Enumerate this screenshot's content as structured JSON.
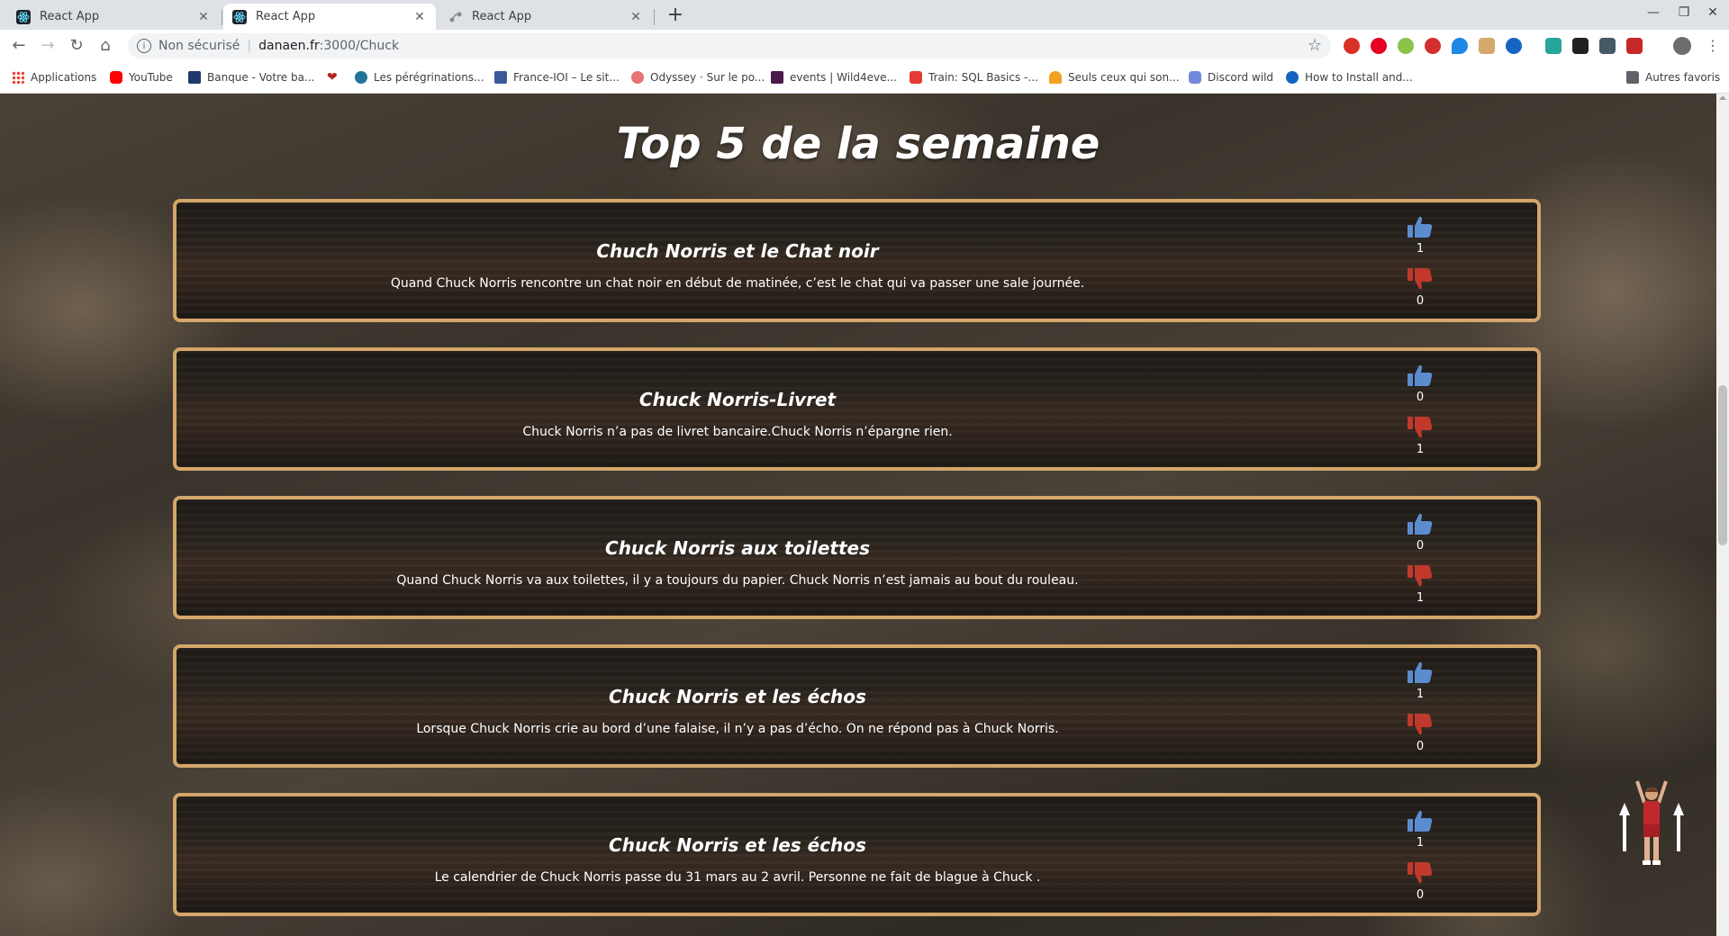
{
  "browser": {
    "tabs": [
      {
        "title": "React App",
        "active": false
      },
      {
        "title": "React App",
        "active": true
      },
      {
        "title": "React App",
        "active": false
      }
    ],
    "address": {
      "security": "Non sécurisé",
      "host": "danaen.fr",
      "path": ":3000/Chuck"
    },
    "bookmarks": [
      {
        "label": "Applications",
        "icon": "apps-grid-icon",
        "color": "#ea4335"
      },
      {
        "label": "YouTube",
        "icon": "youtube-icon",
        "color": "#ff0000"
      },
      {
        "label": "Banque - Votre ba...",
        "icon": "bank-icon",
        "color": "#1e3a6d"
      },
      {
        "label": "",
        "icon": "heart-icon",
        "color": "#b3261e"
      },
      {
        "label": "Les pérégrinations...",
        "icon": "wordpress-icon",
        "color": "#21759b"
      },
      {
        "label": "France-IOI – Le sit...",
        "icon": "franceioi-icon",
        "color": "#3b5998"
      },
      {
        "label": "Odyssey · Sur le po...",
        "icon": "odyssey-icon",
        "color": "#e57373"
      },
      {
        "label": "events | Wild4eve...",
        "icon": "wild-icon",
        "color": "#4a1a4a"
      },
      {
        "label": "Train: SQL Basics -...",
        "icon": "sql-icon",
        "color": "#e53935"
      },
      {
        "label": "Seuls ceux qui son...",
        "icon": "torch-icon",
        "color": "#f4a020"
      },
      {
        "label": "Discord wild",
        "icon": "discord-icon",
        "color": "#7289da"
      },
      {
        "label": "How to Install and...",
        "icon": "install-icon",
        "color": "#1565c0"
      },
      {
        "label": "Autres favoris",
        "icon": "folder-icon",
        "color": "#5f6368"
      }
    ]
  },
  "page": {
    "title": "Top 5 de la semaine",
    "jokes": [
      {
        "title": "Chuch Norris et le Chat noir",
        "text": "Quand Chuck Norris rencontre un chat noir en début de matinée, c’est le chat qui va passer une sale journée.",
        "likes": "1",
        "dislikes": "0"
      },
      {
        "title": "Chuck Norris-Livret",
        "text": "Chuck Norris n’a pas de livret bancaire.Chuck Norris n’épargne rien.",
        "likes": "0",
        "dislikes": "1"
      },
      {
        "title": "Chuck Norris aux toilettes",
        "text": "Quand Chuck Norris va aux toilettes, il y a toujours du papier. Chuck Norris n’est jamais au bout du rouleau.",
        "likes": "0",
        "dislikes": "1"
      },
      {
        "title": "Chuck Norris et les échos",
        "text": "Lorsque Chuck Norris crie au bord d’une falaise, il n’y a pas d’écho. On ne répond pas à Chuck Norris.",
        "likes": "1",
        "dislikes": "0"
      },
      {
        "title": "Chuck Norris et les échos",
        "text": "Le calendrier de Chuck Norris passe du 31 mars au 2 avril. Personne ne fait de blague à Chuck .",
        "likes": "1",
        "dislikes": "0"
      }
    ]
  },
  "colors": {
    "card_border": "#d4a66a",
    "thumb_up": "#5b8ccf",
    "thumb_down": "#c0392b"
  }
}
